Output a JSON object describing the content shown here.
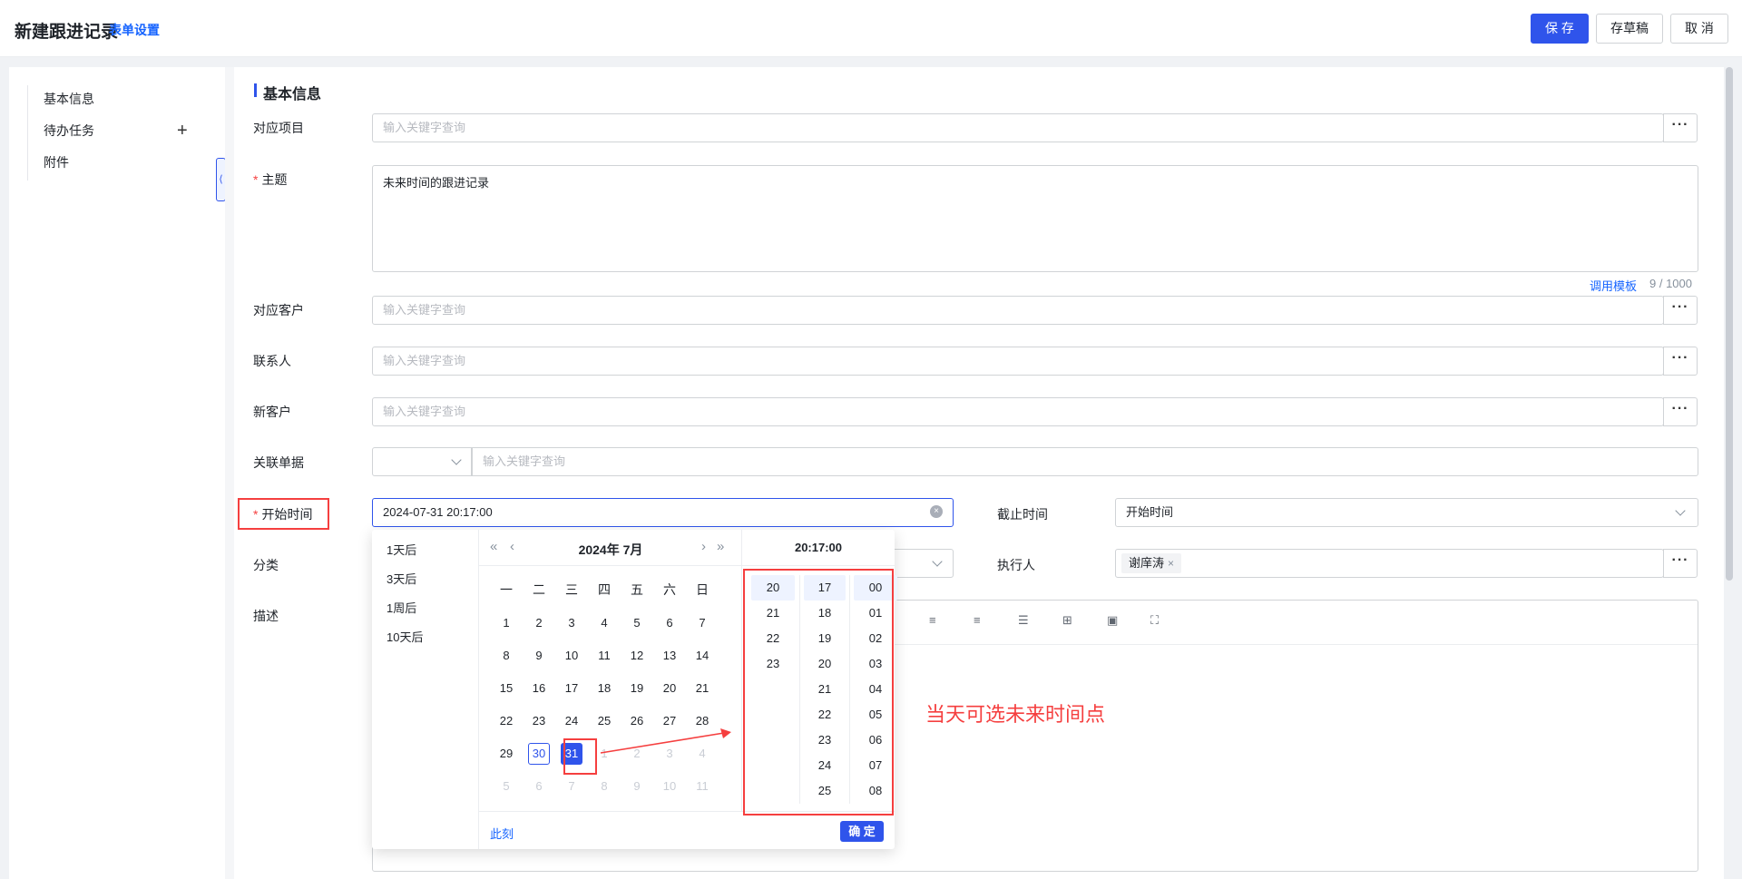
{
  "header": {
    "title": "新建跟进记录",
    "form_settings": "表单设置",
    "save": "保 存",
    "draft": "存草稿",
    "cancel": "取 消"
  },
  "nav": {
    "items": [
      "基本信息",
      "待办任务",
      "附件"
    ],
    "add_icon": "plus-icon",
    "collapse_icon": "chevron-left-icon"
  },
  "section": {
    "title": "基本信息"
  },
  "fields": {
    "project": {
      "label": "对应项目",
      "placeholder": "输入关键字查询"
    },
    "subject": {
      "label": "主题",
      "value": "未来时间的跟进记录",
      "template_link": "调用模板",
      "count": "9 / 1000"
    },
    "customer": {
      "label": "对应客户",
      "placeholder": "输入关键字查询"
    },
    "contact": {
      "label": "联系人",
      "placeholder": "输入关键字查询"
    },
    "new_customer": {
      "label": "新客户",
      "placeholder": "输入关键字查询"
    },
    "related_doc": {
      "label": "关联单据",
      "placeholder": "输入关键字查询"
    },
    "start_time": {
      "label": "开始时间",
      "value": "2024-07-31 20:17:00"
    },
    "end_time": {
      "label": "截止时间",
      "value": "开始时间"
    },
    "category": {
      "label": "分类"
    },
    "executor": {
      "label": "执行人",
      "tag": "谢庠涛",
      "tag_close": "×"
    },
    "description": {
      "label": "描述"
    }
  },
  "picker": {
    "shortcuts": [
      "1天后",
      "3天后",
      "1周后",
      "10天后"
    ],
    "month_title": "2024年  7月",
    "weekdays": [
      "一",
      "二",
      "三",
      "四",
      "五",
      "六",
      "日"
    ],
    "weeks": [
      [
        {
          "d": "1"
        },
        {
          "d": "2"
        },
        {
          "d": "3"
        },
        {
          "d": "4"
        },
        {
          "d": "5"
        },
        {
          "d": "6"
        },
        {
          "d": "7"
        }
      ],
      [
        {
          "d": "8"
        },
        {
          "d": "9"
        },
        {
          "d": "10"
        },
        {
          "d": "11"
        },
        {
          "d": "12"
        },
        {
          "d": "13"
        },
        {
          "d": "14"
        }
      ],
      [
        {
          "d": "15"
        },
        {
          "d": "16"
        },
        {
          "d": "17"
        },
        {
          "d": "18"
        },
        {
          "d": "19"
        },
        {
          "d": "20"
        },
        {
          "d": "21"
        }
      ],
      [
        {
          "d": "22"
        },
        {
          "d": "23"
        },
        {
          "d": "24"
        },
        {
          "d": "25"
        },
        {
          "d": "26"
        },
        {
          "d": "27"
        },
        {
          "d": "28"
        }
      ],
      [
        {
          "d": "29"
        },
        {
          "d": "30",
          "s": "today"
        },
        {
          "d": "31",
          "s": "sel"
        },
        {
          "d": "1",
          "s": "muted"
        },
        {
          "d": "2",
          "s": "muted"
        },
        {
          "d": "3",
          "s": "muted"
        },
        {
          "d": "4",
          "s": "muted"
        }
      ],
      [
        {
          "d": "5",
          "s": "muted"
        },
        {
          "d": "6",
          "s": "muted"
        },
        {
          "d": "7",
          "s": "muted"
        },
        {
          "d": "8",
          "s": "muted"
        },
        {
          "d": "9",
          "s": "muted"
        },
        {
          "d": "10",
          "s": "muted"
        },
        {
          "d": "11",
          "s": "muted"
        }
      ]
    ],
    "time_title": "20:17:00",
    "hours": [
      "20",
      "21",
      "22",
      "23"
    ],
    "minutes": [
      "17",
      "18",
      "19",
      "20",
      "21",
      "22",
      "23",
      "24",
      "25"
    ],
    "seconds": [
      "00",
      "01",
      "02",
      "03",
      "04",
      "05",
      "06",
      "07",
      "08"
    ],
    "now": "此刻",
    "ok": "确 定"
  },
  "annotation": "当天可选未来时间点",
  "accent": "#2f54eb",
  "highlight": "#f53f3f"
}
